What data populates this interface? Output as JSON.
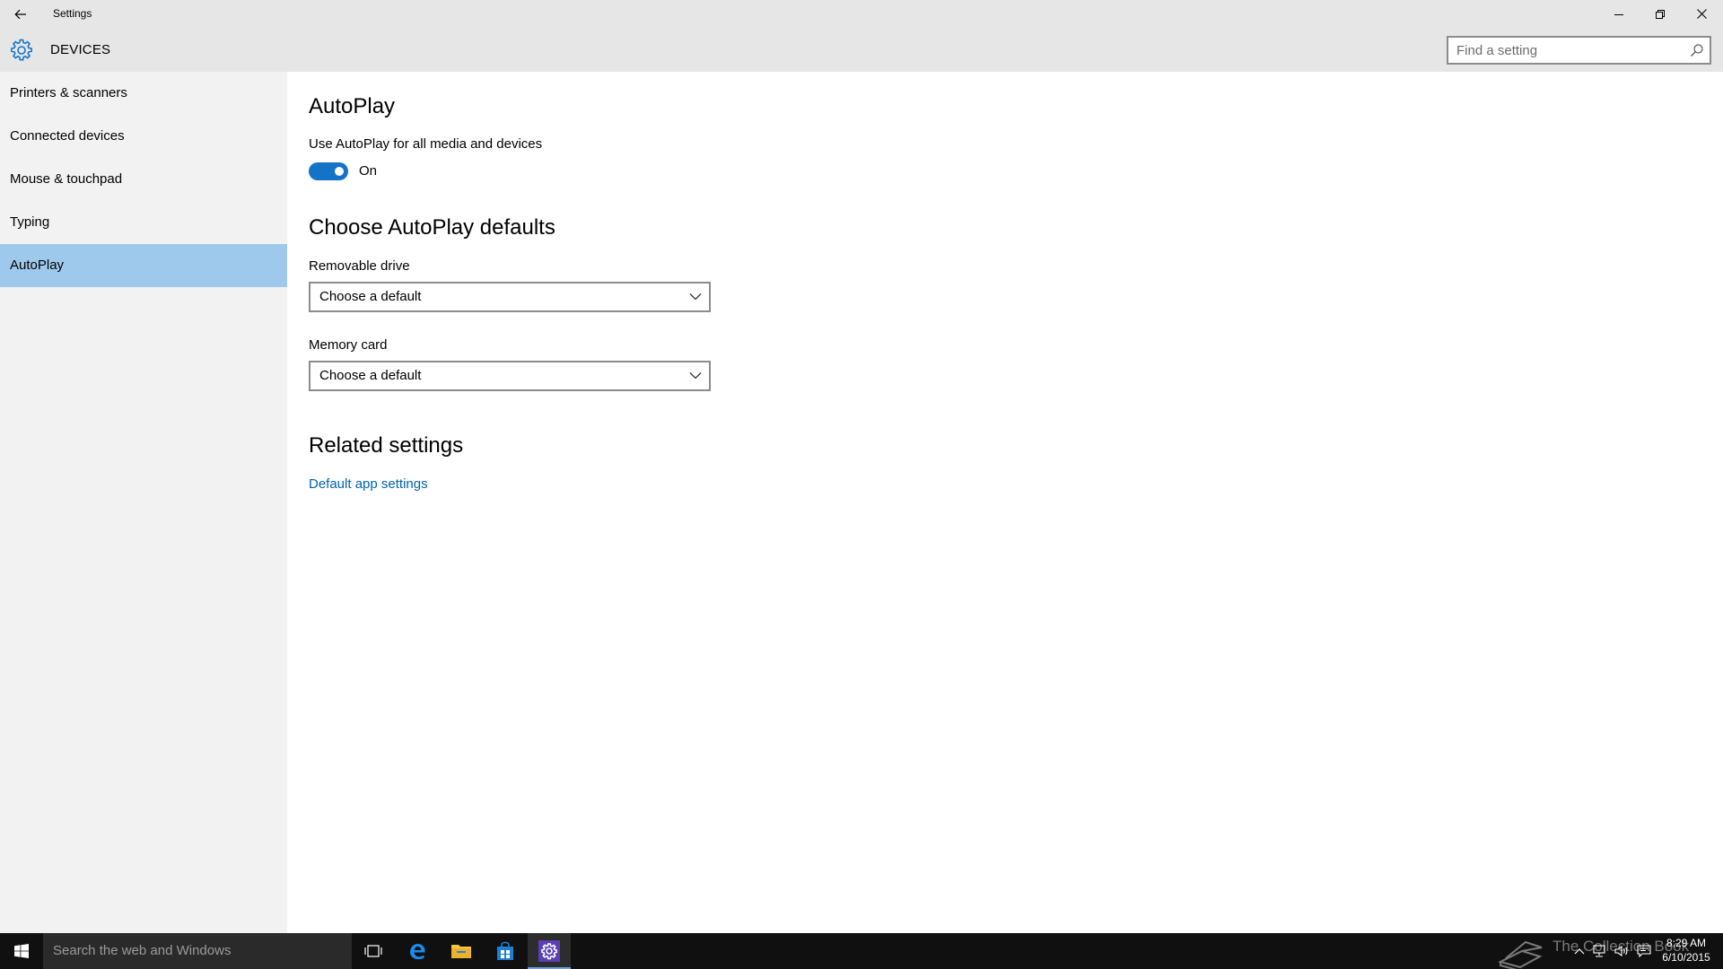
{
  "window": {
    "title": "Settings"
  },
  "header": {
    "section_title": "DEVICES",
    "search_placeholder": "Find a setting"
  },
  "sidebar": {
    "items": [
      {
        "label": "Printers & scanners",
        "selected": false
      },
      {
        "label": "Connected devices",
        "selected": false
      },
      {
        "label": "Mouse & touchpad",
        "selected": false
      },
      {
        "label": "Typing",
        "selected": false
      },
      {
        "label": "AutoPlay",
        "selected": true
      }
    ]
  },
  "main": {
    "page_title": "AutoPlay",
    "toggle": {
      "label": "Use AutoPlay for all media and devices",
      "state_label": "On",
      "on": true
    },
    "defaults_heading": "Choose AutoPlay defaults",
    "removable_drive": {
      "label": "Removable drive",
      "value": "Choose a default"
    },
    "memory_card": {
      "label": "Memory card",
      "value": "Choose a default"
    },
    "related_heading": "Related settings",
    "related_link": "Default app settings"
  },
  "taskbar": {
    "search_placeholder": "Search the web and Windows",
    "watermark": "The Collection Book",
    "time": "8:29 AM",
    "date": "6/10/2015"
  },
  "colors": {
    "accent": "#1373c9",
    "selected_nav": "#9fc9ec",
    "link": "#0063b1",
    "chrome": "#e6e6e6",
    "sidebar": "#f2f2f2",
    "taskbar": "#101010"
  }
}
